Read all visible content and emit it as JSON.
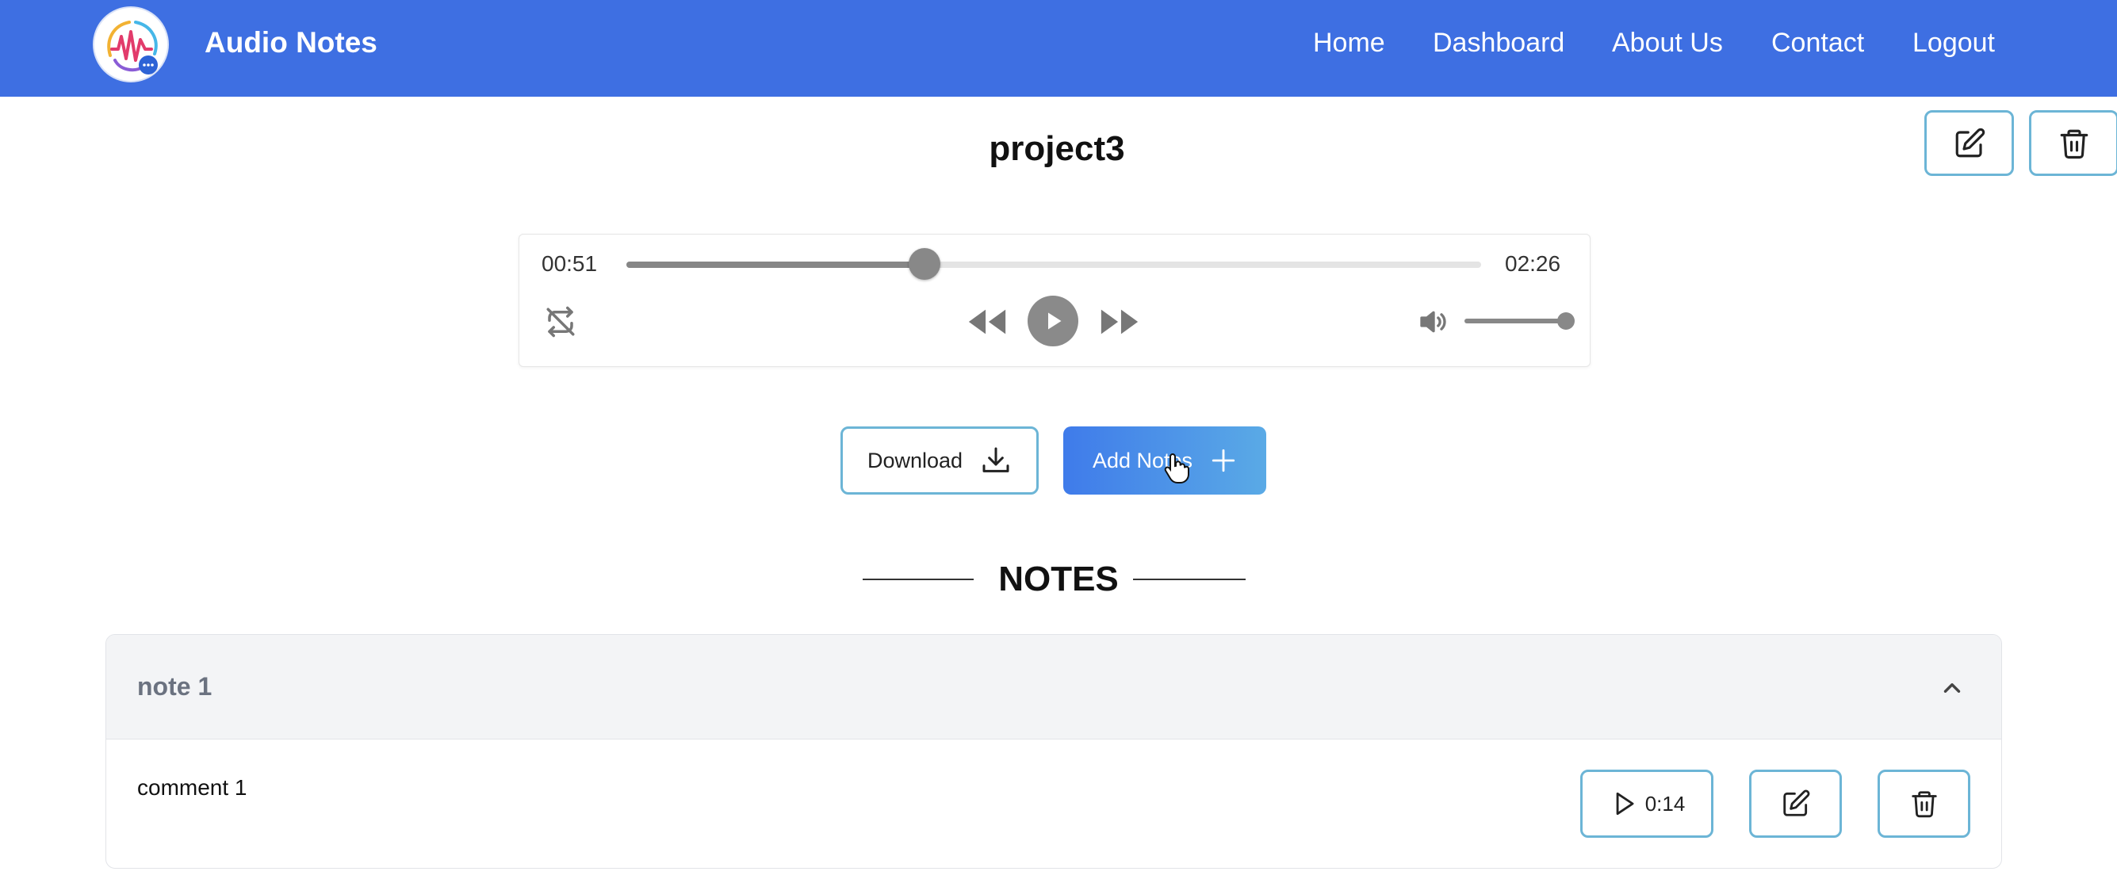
{
  "app": {
    "title": "Audio Notes",
    "logo_icon": "audio-waveform-chat-logo"
  },
  "nav": {
    "items": [
      "Home",
      "Dashboard",
      "About Us",
      "Contact",
      "Logout"
    ]
  },
  "project": {
    "title": "project3",
    "edit_icon": "edit-icon",
    "delete_icon": "trash-icon"
  },
  "player": {
    "current_time": "00:51",
    "duration": "02:26",
    "progress": 0.349,
    "volume": 1.0,
    "icons": [
      "repeat-off-icon",
      "rewind-icon",
      "play-icon",
      "fast-forward-icon",
      "volume-icon"
    ]
  },
  "actions": {
    "download_label": "Download",
    "add_notes_label": "Add Notes"
  },
  "notes": {
    "heading": "NOTES",
    "items": [
      {
        "title": "note 1",
        "comment": "comment 1",
        "timestamp": "0:14"
      }
    ]
  },
  "colors": {
    "navbar": "#3e6fe2",
    "button_border": "#6cb5d6",
    "accent_gradient_start": "#3f7bea",
    "accent_gradient_end": "#5aaae6",
    "note_header_bg": "#f3f4f6"
  }
}
